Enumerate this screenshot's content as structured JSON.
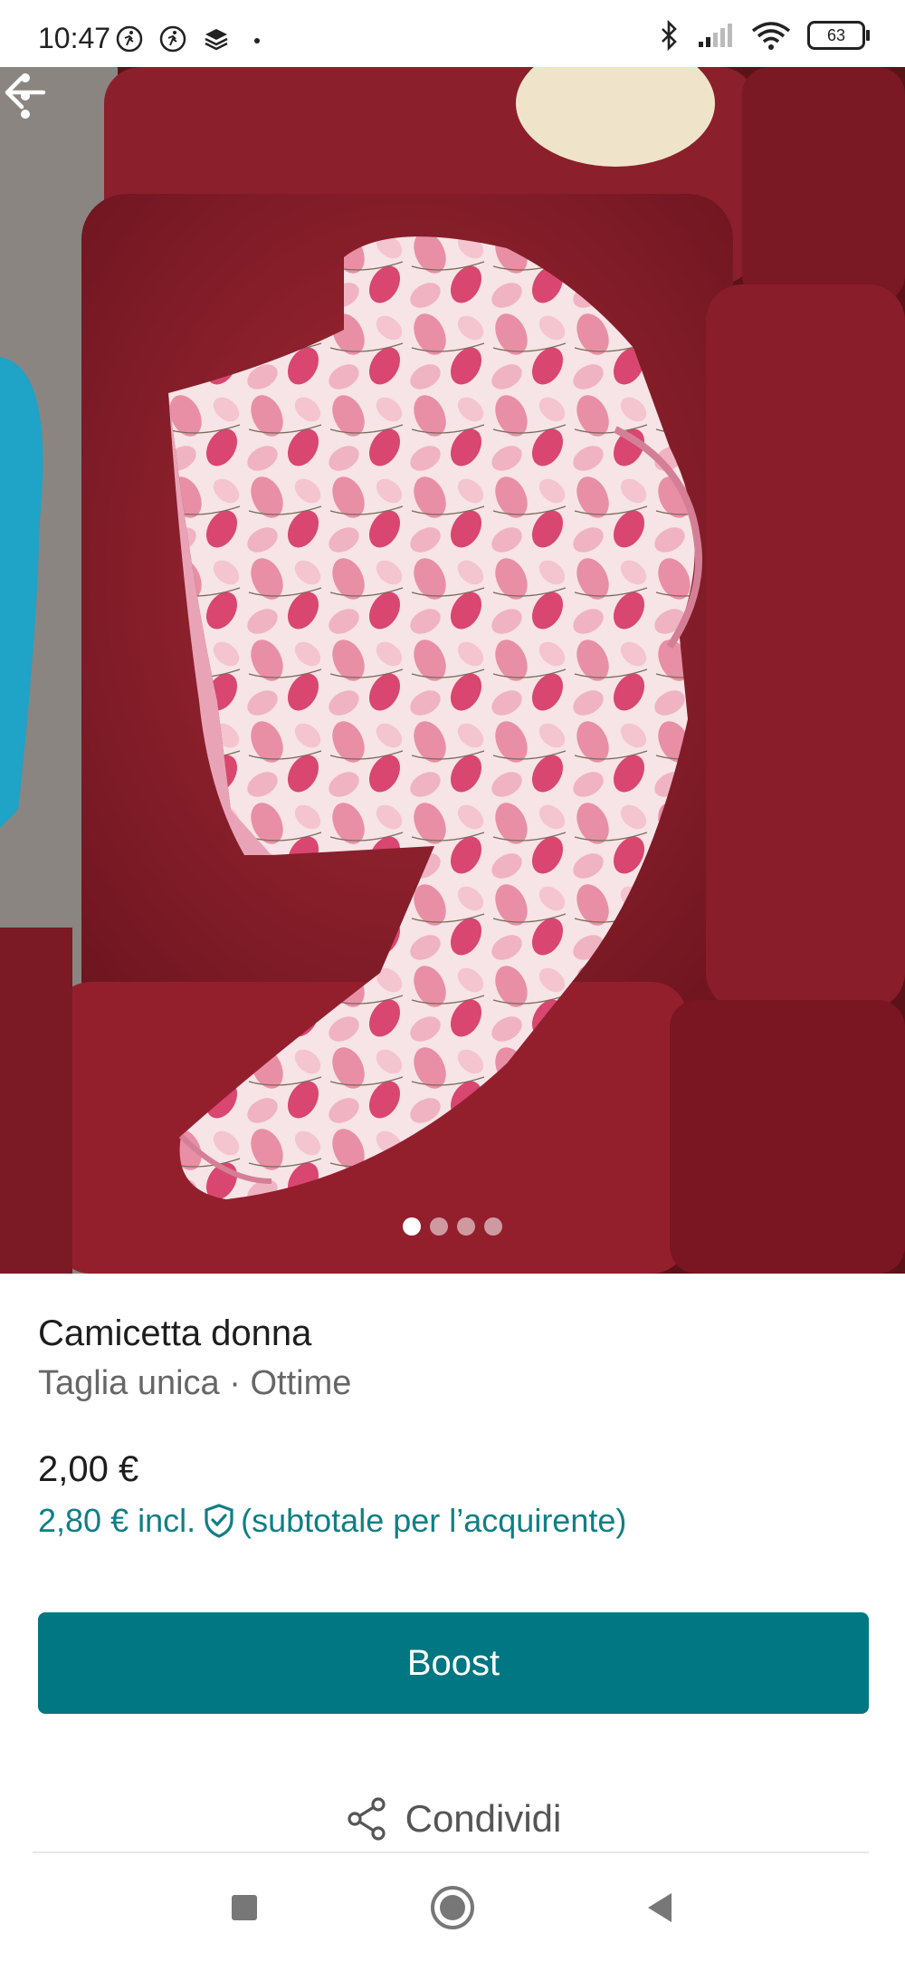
{
  "status_bar": {
    "time": "10:47",
    "battery": "63",
    "icons": [
      "running-icon",
      "running-icon",
      "stack-icon",
      "dot-icon",
      "bluetooth-icon",
      "signal-icon",
      "wifi-icon",
      "battery-icon"
    ]
  },
  "photo": {
    "image_count": 4,
    "active_index": 0,
    "icons": [
      "back-arrow-icon",
      "more-vert-icon"
    ]
  },
  "item": {
    "title": "Camicetta donna",
    "subtitle": "Taglia unica · Ottime",
    "price": "2,00 €",
    "price_incl": "2,80 € incl.",
    "price_note": "(subtotale per l’acquirente)"
  },
  "actions": {
    "boost_label": "Boost",
    "share_label": "Condividi"
  },
  "colors": {
    "accent": "#007782",
    "incl_text": "#0f7f86"
  },
  "system_nav": {
    "icons": [
      "recents-square-icon",
      "home-circle-icon",
      "back-triangle-icon"
    ]
  }
}
